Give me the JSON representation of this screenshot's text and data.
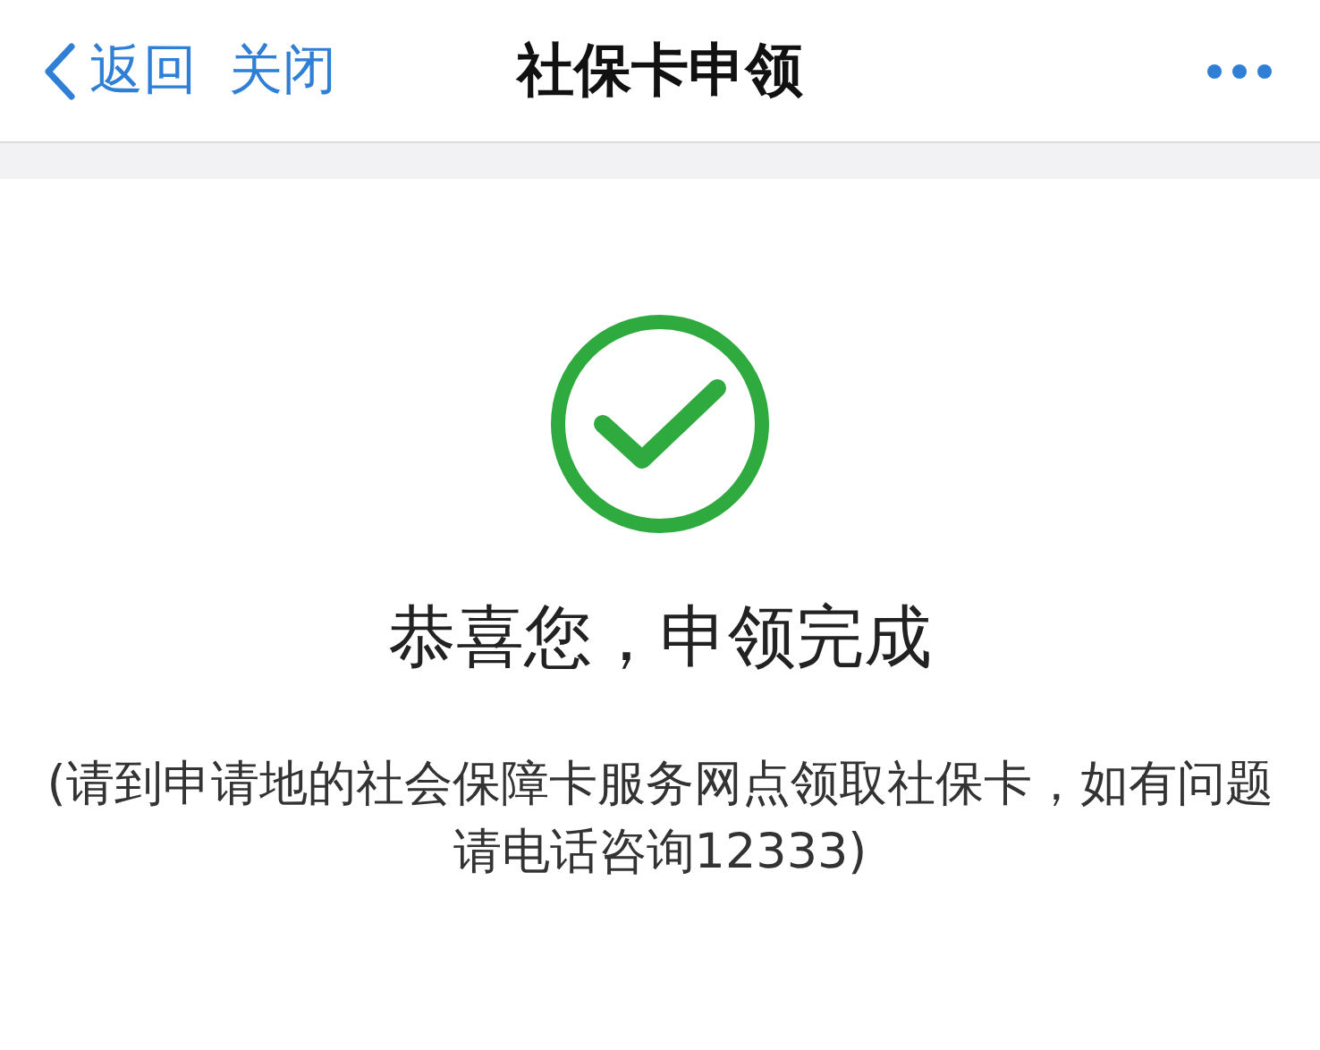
{
  "nav_bar": {
    "back_label": "返回",
    "close_label": "关闭",
    "title": "社保卡申领"
  },
  "result": {
    "title": "恭喜您，申领完成",
    "message": "(请到申请地的社会保障卡服务网点领取社保卡，如有问题请电话咨询12333)"
  }
}
